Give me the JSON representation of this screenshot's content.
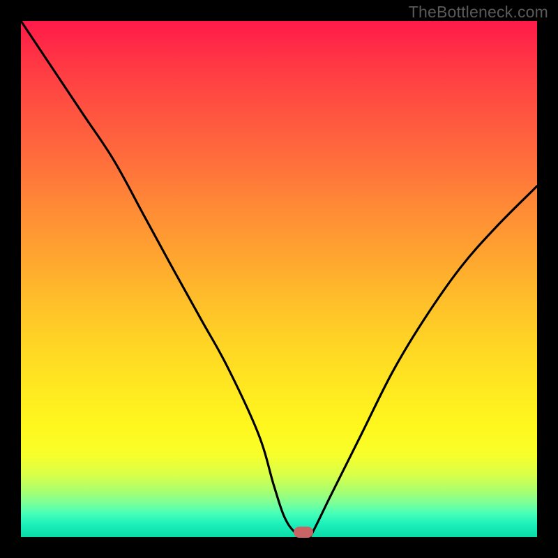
{
  "watermark": "TheBottleneck.com",
  "chart_data": {
    "type": "line",
    "title": "",
    "xlabel": "",
    "ylabel": "",
    "xlim": [
      0,
      100
    ],
    "ylim": [
      0,
      100
    ],
    "grid": false,
    "series": [
      {
        "name": "curve",
        "x": [
          0,
          6,
          12,
          18,
          24,
          30,
          35,
          40,
          46,
          49,
          51,
          53,
          55,
          56,
          60,
          66,
          72,
          78,
          85,
          92,
          100
        ],
        "values": [
          100,
          91,
          82,
          73,
          62,
          51,
          42,
          33,
          20,
          10,
          4,
          1,
          0,
          0,
          8,
          20,
          32,
          42,
          52,
          60,
          68
        ]
      }
    ],
    "marker": {
      "x": 54.7,
      "y_value": 0
    },
    "background_gradient": {
      "top": "#ff1a4a",
      "mid": "#ffd624",
      "bottom": "#0adba8"
    }
  },
  "colors": {
    "frame": "#000000",
    "curve": "#000000",
    "marker": "#c86464",
    "watermark": "#5a5a5a"
  }
}
